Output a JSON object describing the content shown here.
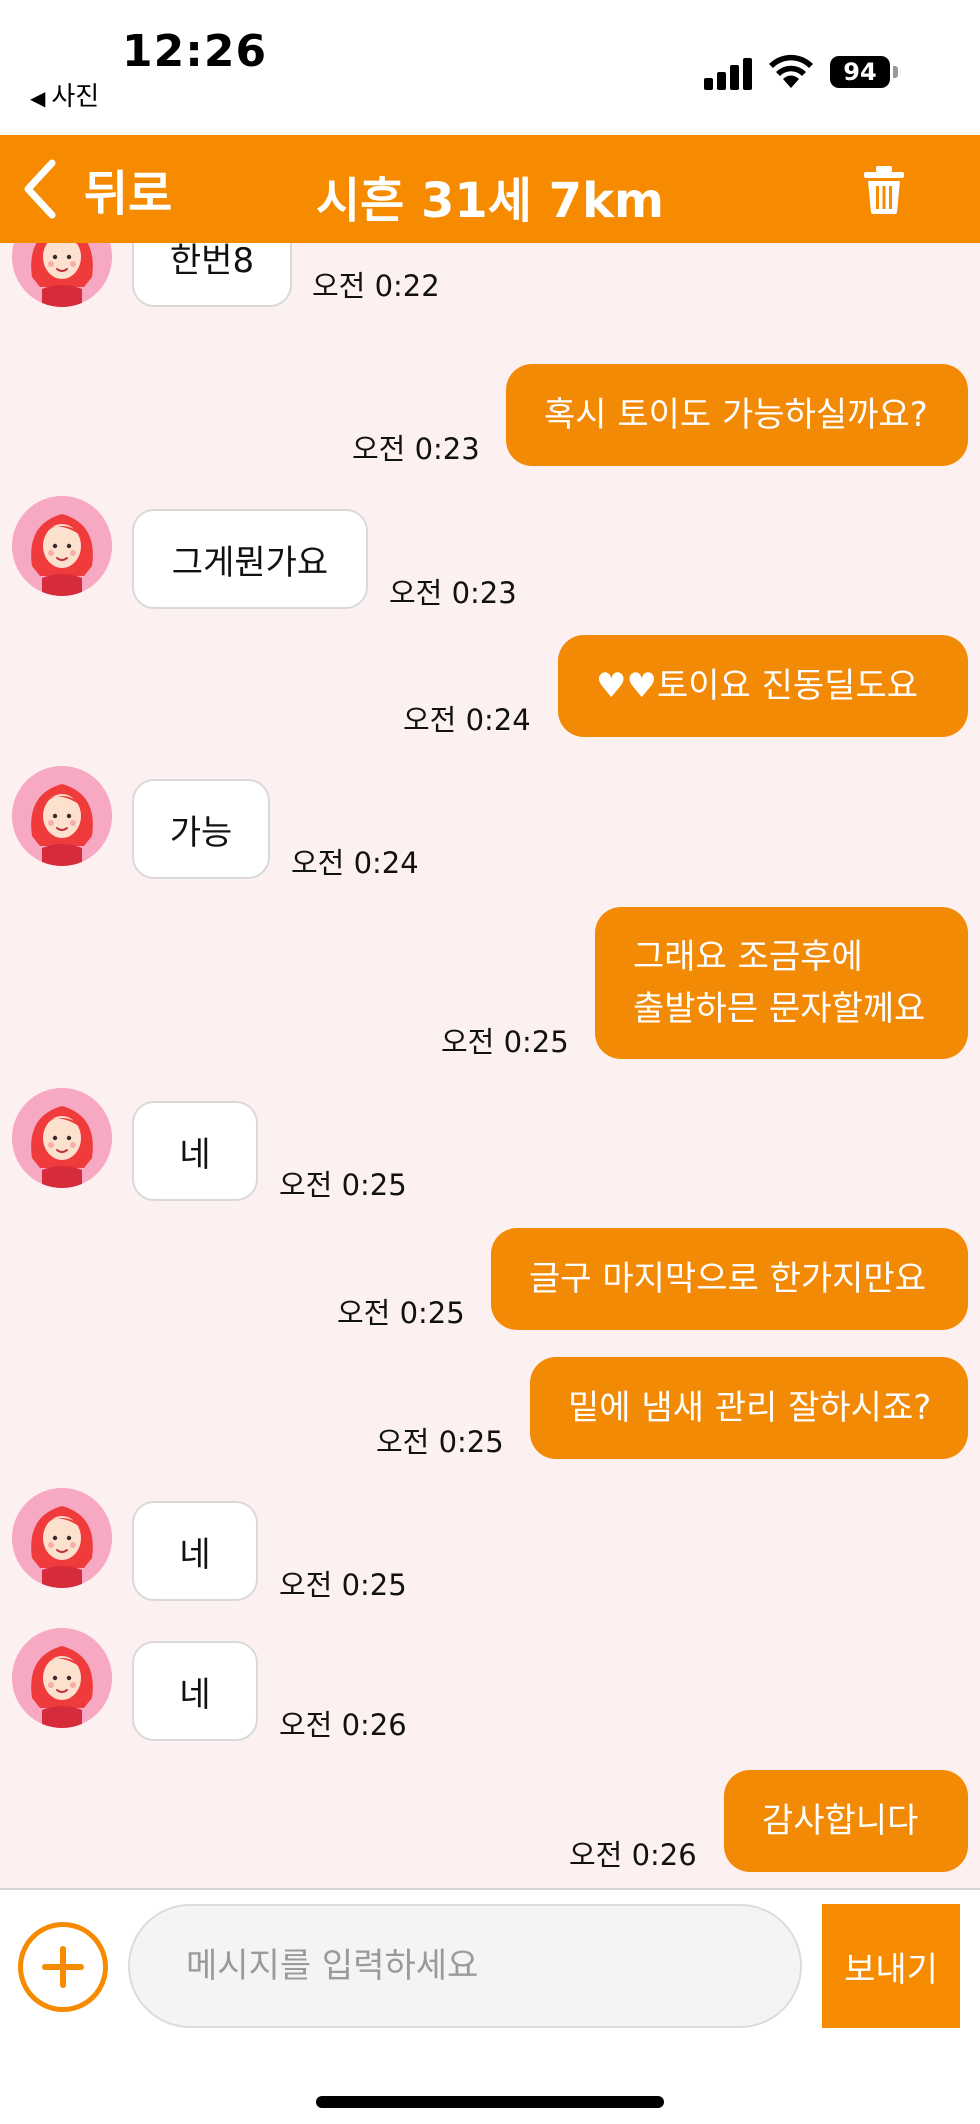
{
  "status_bar": {
    "time": "12:26",
    "back_app": "사진",
    "battery": "94"
  },
  "header": {
    "back_label": "뒤로",
    "title": "시흔 31세 7km"
  },
  "messages": [
    {
      "dir": "in",
      "text": "한번8",
      "time": "오전 0:22"
    },
    {
      "dir": "out",
      "text": "혹시 토이도 가능하실까요?",
      "time": "오전 0:23"
    },
    {
      "dir": "in",
      "text": "그게뭔가요",
      "time": "오전 0:23"
    },
    {
      "dir": "out",
      "text": "♥♥토이요 진동딜도요",
      "time": "오전 0:24"
    },
    {
      "dir": "in",
      "text": "가능",
      "time": "오전 0:24"
    },
    {
      "dir": "out",
      "line1": "그래요 조금후에",
      "line2": "출발하믄 문자할께요",
      "time": "오전 0:25"
    },
    {
      "dir": "in",
      "text": "네",
      "time": "오전 0:25"
    },
    {
      "dir": "out",
      "text": "글구 마지막으로 한가지만요",
      "time": "오전 0:25"
    },
    {
      "dir": "out",
      "text": "밑에 냄새 관리 잘하시죠?",
      "time": "오전 0:25"
    },
    {
      "dir": "in",
      "text": "네",
      "time": "오전 0:25"
    },
    {
      "dir": "in",
      "text": "네",
      "time": "오전 0:26"
    },
    {
      "dir": "out",
      "text": "감사합니다",
      "time": "오전 0:26"
    }
  ],
  "input": {
    "placeholder": "메시지를 입력하세요",
    "send_label": "보내기"
  },
  "colors": {
    "accent": "#f68b00",
    "chat_background": "#fdf0f0",
    "incoming_bubble": "#ffffff"
  },
  "icons": [
    "chevron-left-icon",
    "trash-icon",
    "plus-icon",
    "signal-icon",
    "wifi-icon",
    "battery-icon"
  ]
}
